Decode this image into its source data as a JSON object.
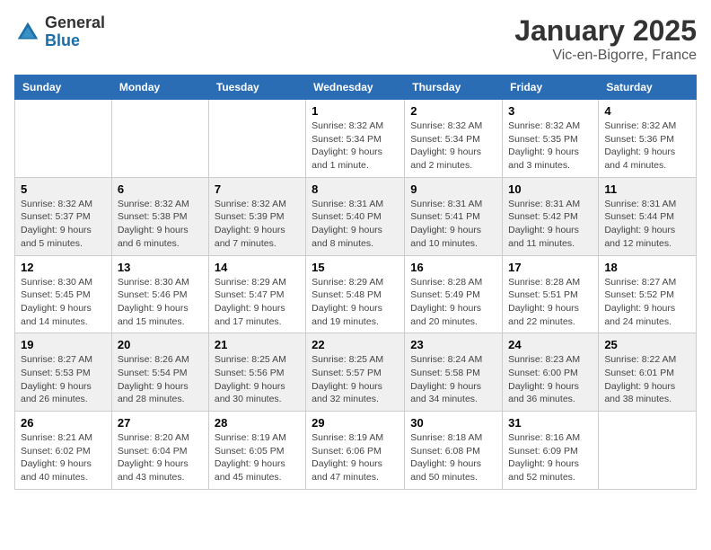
{
  "logo": {
    "general": "General",
    "blue": "Blue"
  },
  "title": "January 2025",
  "location": "Vic-en-Bigorre, France",
  "weekdays": [
    "Sunday",
    "Monday",
    "Tuesday",
    "Wednesday",
    "Thursday",
    "Friday",
    "Saturday"
  ],
  "weeks": [
    [
      {
        "day": "",
        "info": ""
      },
      {
        "day": "",
        "info": ""
      },
      {
        "day": "",
        "info": ""
      },
      {
        "day": "1",
        "info": "Sunrise: 8:32 AM\nSunset: 5:34 PM\nDaylight: 9 hours\nand 1 minute."
      },
      {
        "day": "2",
        "info": "Sunrise: 8:32 AM\nSunset: 5:34 PM\nDaylight: 9 hours\nand 2 minutes."
      },
      {
        "day": "3",
        "info": "Sunrise: 8:32 AM\nSunset: 5:35 PM\nDaylight: 9 hours\nand 3 minutes."
      },
      {
        "day": "4",
        "info": "Sunrise: 8:32 AM\nSunset: 5:36 PM\nDaylight: 9 hours\nand 4 minutes."
      }
    ],
    [
      {
        "day": "5",
        "info": "Sunrise: 8:32 AM\nSunset: 5:37 PM\nDaylight: 9 hours\nand 5 minutes."
      },
      {
        "day": "6",
        "info": "Sunrise: 8:32 AM\nSunset: 5:38 PM\nDaylight: 9 hours\nand 6 minutes."
      },
      {
        "day": "7",
        "info": "Sunrise: 8:32 AM\nSunset: 5:39 PM\nDaylight: 9 hours\nand 7 minutes."
      },
      {
        "day": "8",
        "info": "Sunrise: 8:31 AM\nSunset: 5:40 PM\nDaylight: 9 hours\nand 8 minutes."
      },
      {
        "day": "9",
        "info": "Sunrise: 8:31 AM\nSunset: 5:41 PM\nDaylight: 9 hours\nand 10 minutes."
      },
      {
        "day": "10",
        "info": "Sunrise: 8:31 AM\nSunset: 5:42 PM\nDaylight: 9 hours\nand 11 minutes."
      },
      {
        "day": "11",
        "info": "Sunrise: 8:31 AM\nSunset: 5:44 PM\nDaylight: 9 hours\nand 12 minutes."
      }
    ],
    [
      {
        "day": "12",
        "info": "Sunrise: 8:30 AM\nSunset: 5:45 PM\nDaylight: 9 hours\nand 14 minutes."
      },
      {
        "day": "13",
        "info": "Sunrise: 8:30 AM\nSunset: 5:46 PM\nDaylight: 9 hours\nand 15 minutes."
      },
      {
        "day": "14",
        "info": "Sunrise: 8:29 AM\nSunset: 5:47 PM\nDaylight: 9 hours\nand 17 minutes."
      },
      {
        "day": "15",
        "info": "Sunrise: 8:29 AM\nSunset: 5:48 PM\nDaylight: 9 hours\nand 19 minutes."
      },
      {
        "day": "16",
        "info": "Sunrise: 8:28 AM\nSunset: 5:49 PM\nDaylight: 9 hours\nand 20 minutes."
      },
      {
        "day": "17",
        "info": "Sunrise: 8:28 AM\nSunset: 5:51 PM\nDaylight: 9 hours\nand 22 minutes."
      },
      {
        "day": "18",
        "info": "Sunrise: 8:27 AM\nSunset: 5:52 PM\nDaylight: 9 hours\nand 24 minutes."
      }
    ],
    [
      {
        "day": "19",
        "info": "Sunrise: 8:27 AM\nSunset: 5:53 PM\nDaylight: 9 hours\nand 26 minutes."
      },
      {
        "day": "20",
        "info": "Sunrise: 8:26 AM\nSunset: 5:54 PM\nDaylight: 9 hours\nand 28 minutes."
      },
      {
        "day": "21",
        "info": "Sunrise: 8:25 AM\nSunset: 5:56 PM\nDaylight: 9 hours\nand 30 minutes."
      },
      {
        "day": "22",
        "info": "Sunrise: 8:25 AM\nSunset: 5:57 PM\nDaylight: 9 hours\nand 32 minutes."
      },
      {
        "day": "23",
        "info": "Sunrise: 8:24 AM\nSunset: 5:58 PM\nDaylight: 9 hours\nand 34 minutes."
      },
      {
        "day": "24",
        "info": "Sunrise: 8:23 AM\nSunset: 6:00 PM\nDaylight: 9 hours\nand 36 minutes."
      },
      {
        "day": "25",
        "info": "Sunrise: 8:22 AM\nSunset: 6:01 PM\nDaylight: 9 hours\nand 38 minutes."
      }
    ],
    [
      {
        "day": "26",
        "info": "Sunrise: 8:21 AM\nSunset: 6:02 PM\nDaylight: 9 hours\nand 40 minutes."
      },
      {
        "day": "27",
        "info": "Sunrise: 8:20 AM\nSunset: 6:04 PM\nDaylight: 9 hours\nand 43 minutes."
      },
      {
        "day": "28",
        "info": "Sunrise: 8:19 AM\nSunset: 6:05 PM\nDaylight: 9 hours\nand 45 minutes."
      },
      {
        "day": "29",
        "info": "Sunrise: 8:19 AM\nSunset: 6:06 PM\nDaylight: 9 hours\nand 47 minutes."
      },
      {
        "day": "30",
        "info": "Sunrise: 8:18 AM\nSunset: 6:08 PM\nDaylight: 9 hours\nand 50 minutes."
      },
      {
        "day": "31",
        "info": "Sunrise: 8:16 AM\nSunset: 6:09 PM\nDaylight: 9 hours\nand 52 minutes."
      },
      {
        "day": "",
        "info": ""
      }
    ]
  ]
}
